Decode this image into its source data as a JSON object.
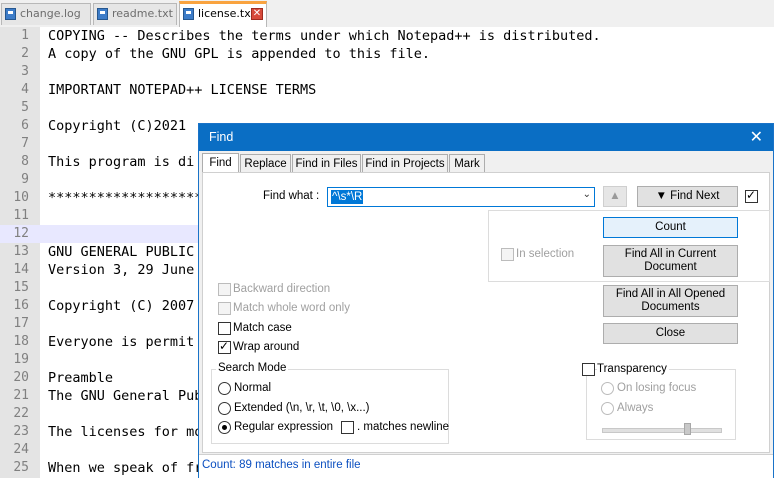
{
  "tabs": [
    {
      "name": "change.log",
      "active": false
    },
    {
      "name": "readme.txt",
      "active": false
    },
    {
      "name": "license.txt",
      "active": true
    }
  ],
  "editor": {
    "lines": [
      {
        "n": "1",
        "text": "COPYING -- Describes the terms under which Notepad++ is distributed."
      },
      {
        "n": "2",
        "text": "A copy of the GNU GPL is appended to this file."
      },
      {
        "n": "3",
        "text": ""
      },
      {
        "n": "4",
        "text": "IMPORTANT NOTEPAD++ LICENSE TERMS"
      },
      {
        "n": "5",
        "text": ""
      },
      {
        "n": "6",
        "text": "Copyright (C)2021"
      },
      {
        "n": "7",
        "text": ""
      },
      {
        "n": "8",
        "text": "This program is di"
      },
      {
        "n": "9",
        "text": ""
      },
      {
        "n": "10",
        "text": "*******************"
      },
      {
        "n": "11",
        "text": ""
      },
      {
        "n": "12",
        "text": ""
      },
      {
        "n": "13",
        "text": "GNU GENERAL PUBLIC"
      },
      {
        "n": "14",
        "text": "Version 3, 29 June"
      },
      {
        "n": "15",
        "text": ""
      },
      {
        "n": "16",
        "text": "Copyright (C) 2007"
      },
      {
        "n": "17",
        "text": ""
      },
      {
        "n": "18",
        "text": "Everyone is permit"
      },
      {
        "n": "19",
        "text": ""
      },
      {
        "n": "20",
        "text": "Preamble"
      },
      {
        "n": "21",
        "text": "The GNU General Pub"
      },
      {
        "n": "22",
        "text": ""
      },
      {
        "n": "23",
        "text": "The licenses for mo"
      },
      {
        "n": "24",
        "text": ""
      },
      {
        "n": "25",
        "text": "When we speak of fr"
      }
    ],
    "current_line": "12"
  },
  "find_dialog": {
    "title": "Find",
    "close_glyph": "✕",
    "tabs": [
      "Find",
      "Replace",
      "Find in Files",
      "Find in Projects",
      "Mark"
    ],
    "active_tab": "Find",
    "find_what_label": "Find what :",
    "find_what_value": "^\\s*\\R",
    "up_glyph": "▲",
    "find_next_label": "▼ Find Next",
    "count_label": "Count",
    "in_selection_label": "In selection",
    "find_all_current_label": "Find All in Current Document",
    "find_all_opened_label": "Find All in All Opened Documents",
    "close_label": "Close",
    "backward_label": "Backward direction",
    "whole_word_label": "Match whole word only",
    "match_case_label": "Match case",
    "wrap_around_label": "Wrap around",
    "search_mode_label": "Search Mode",
    "mode_normal_label": "Normal",
    "mode_extended_label": "Extended (\\n, \\r, \\t, \\0, \\x...)",
    "mode_regex_label": "Regular expression",
    "matches_newline_label": ". matches newline",
    "transparency_label": "Transparency",
    "on_losing_focus_label": "On losing focus",
    "always_label": "Always",
    "status_text": "Count: 89 matches in entire file"
  }
}
